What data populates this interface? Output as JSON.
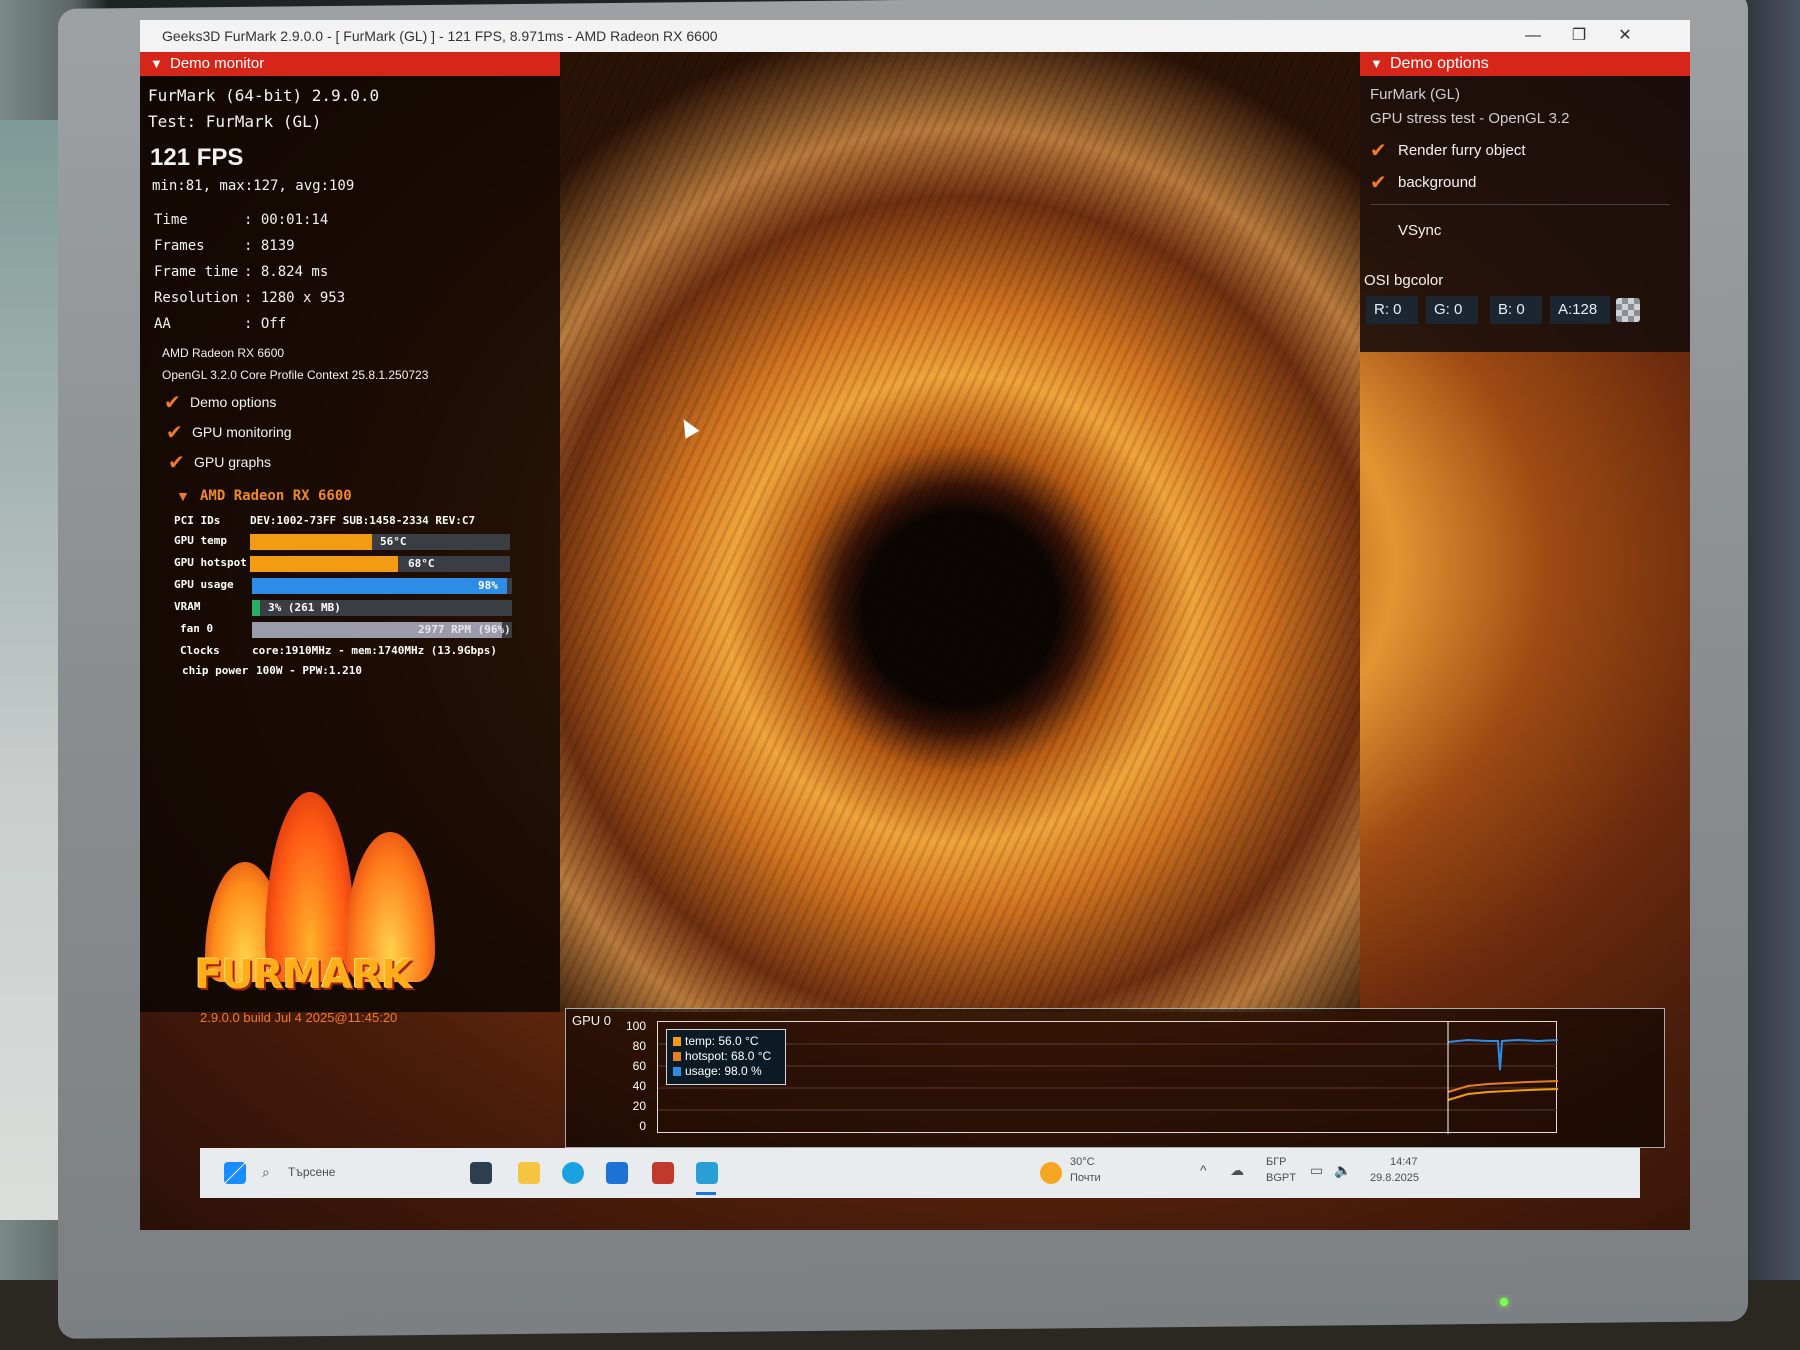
{
  "window": {
    "title": "Geeks3D FurMark 2.9.0.0 - [ FurMark (GL) ] - 121 FPS, 8.971ms - AMD Radeon RX 6600",
    "minimize": "—",
    "maximize": "❐",
    "close": "✕"
  },
  "demo_monitor": {
    "header": "Demo monitor",
    "app_line": "FurMark (64-bit) 2.9.0.0",
    "test_line": "Test: FurMark (GL)",
    "fps": "121 FPS",
    "fps_stats": "min:81, max:127, avg:109",
    "stats": [
      {
        "label": "Time",
        "value": ": 00:01:14"
      },
      {
        "label": "Frames",
        "value": ": 8139"
      },
      {
        "label": "Frame time",
        "value": ": 8.824 ms"
      },
      {
        "label": "Resolution",
        "value": ": 1280 x 953"
      },
      {
        "label": "AA",
        "value": ": Off"
      }
    ],
    "gpu_name": "AMD Radeon RX 6600",
    "opengl": "OpenGL 3.2.0 Core Profile Context 25.8.1.250723",
    "toggles": [
      "Demo options",
      "GPU monitoring",
      "GPU graphs"
    ]
  },
  "gpu_panel": {
    "header": "AMD Radeon RX 6600",
    "pci_label": "PCI IDs",
    "pci_value": "DEV:1002-73FF SUB:1458-2334 REV:C7",
    "gpu_temp_label": "GPU temp",
    "gpu_temp_text": "56°C",
    "gpu_temp_fill": 0.47,
    "hotspot_label": "GPU hotspot",
    "hotspot_text": "68°C",
    "hotspot_fill": 0.57,
    "usage_label": "GPU usage",
    "usage_text": "98%",
    "usage_fill": 0.98,
    "vram_label": "VRAM",
    "vram_text": "3% (261 MB)",
    "vram_fill": 0.03,
    "fan_label": "fan 0",
    "fan_text": "2977 RPM (96%)",
    "fan_fill": 0.96,
    "clocks_label": "Clocks",
    "clocks_value": "core:1910MHz - mem:1740MHz (13.9Gbps)",
    "power_label": "chip power",
    "power_value": "100W - PPW:1.210"
  },
  "logo": {
    "wordmark": "FURMARK",
    "build": "2.9.0.0 build Jul  4 2025@11:45:20"
  },
  "demo_options": {
    "header": "Demo options",
    "demo_name": "FurMark (GL)",
    "demo_desc": "GPU stress test - OpenGL 3.2",
    "options": [
      {
        "label": "Render furry object",
        "checked": true
      },
      {
        "label": "background",
        "checked": true
      },
      {
        "label": "VSync",
        "checked": false
      }
    ],
    "osi_label": "OSI bgcolor",
    "r": "R: 0",
    "g": "G: 0",
    "b": "B: 0",
    "a": "A:128"
  },
  "graph": {
    "title": "GPU 0",
    "yticks": [
      "100",
      "80",
      "60",
      "40",
      "20",
      "0"
    ],
    "legend": [
      {
        "label": "temp: 56.0 °C",
        "color": "#f39c12"
      },
      {
        "label": "hotspot: 68.0 °C",
        "color": "#e67e22"
      },
      {
        "label": "usage: 98.0 %",
        "color": "#2d8ce6"
      }
    ]
  },
  "taskbar": {
    "search_placeholder": "Търсене",
    "weather_temp": "30°C",
    "weather_desc": "Почти",
    "lang_top": "БГР",
    "lang_bottom": "BGPT",
    "time": "14:47",
    "date": "29.8.2025"
  },
  "colors": {
    "accent_red": "#d6261a",
    "check_orange": "#f07a2a",
    "temp_bar": "#f39c12",
    "usage_bar": "#2d8ce6"
  }
}
